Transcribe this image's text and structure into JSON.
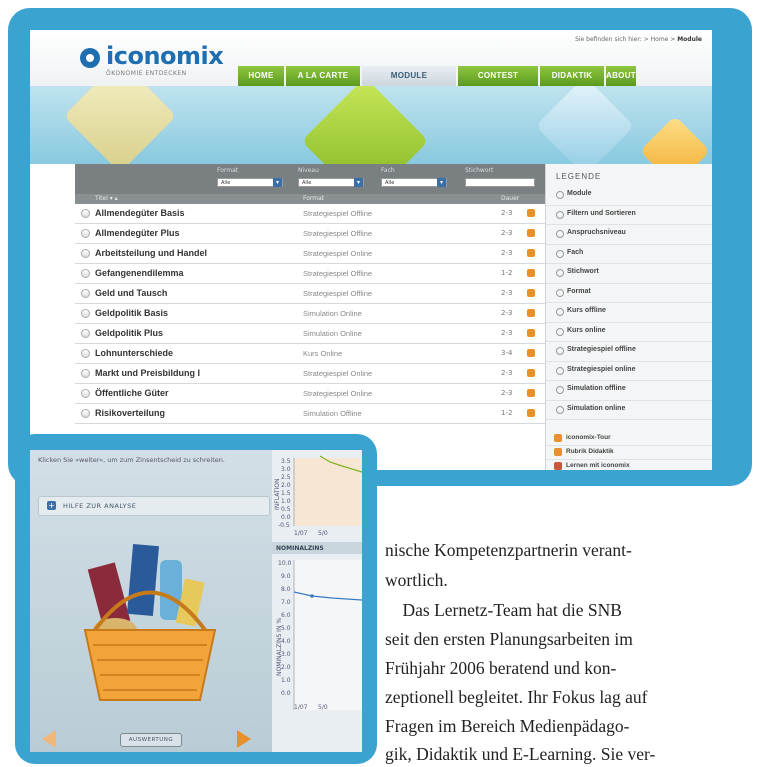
{
  "header": {
    "logo_text": "iconomix",
    "logo_sub": "ÖKONOMIE ENTDECKEN",
    "breadcrumb_prefix": "Sie befinden sich hier: > Home > ",
    "breadcrumb_current": "Module"
  },
  "nav": [
    {
      "label": "HOME"
    },
    {
      "label": "A LA CARTE"
    },
    {
      "label": "MODULE"
    },
    {
      "label": "CONTEST"
    },
    {
      "label": "DIDAKTIK"
    },
    {
      "label": "ABOUT"
    }
  ],
  "filters": {
    "format_label": "Format",
    "niveau_label": "Niveau",
    "fach_label": "Fach",
    "stichwort_label": "Stichwort",
    "format_value": "Alle",
    "niveau_value": "Alle",
    "fach_value": "Alle"
  },
  "table": {
    "col_title": "Titel ▾ ▴",
    "col_format": "Format",
    "col_dauer": "Dauer",
    "rows": [
      {
        "name": "Allmendegüter Basis",
        "format": "Strategiespiel Offline",
        "duration": "2-3"
      },
      {
        "name": "Allmendegüter Plus",
        "format": "Strategiespiel Offline",
        "duration": "2-3"
      },
      {
        "name": "Arbeitsteilung und Handel",
        "format": "Strategiespiel Online",
        "duration": "2-3"
      },
      {
        "name": "Gefangenendilemma",
        "format": "Strategiespiel Offline",
        "duration": "1-2"
      },
      {
        "name": "Geld und Tausch",
        "format": "Strategiespiel Offline",
        "duration": "2-3"
      },
      {
        "name": "Geldpolitik Basis",
        "format": "Simulation Online",
        "duration": "2-3"
      },
      {
        "name": "Geldpolitik Plus",
        "format": "Simulation Online",
        "duration": "2-3"
      },
      {
        "name": "Lohnunterschiede",
        "format": "Kurs Online",
        "duration": "3-4"
      },
      {
        "name": "Markt und Preisbildung I",
        "format": "Strategiespiel Online",
        "duration": "2-3"
      },
      {
        "name": "Öffentliche Güter",
        "format": "Strategiespiel Online",
        "duration": "2-3"
      },
      {
        "name": "Risikoverteilung",
        "format": "Simulation Offline",
        "duration": "1-2"
      }
    ]
  },
  "legend": {
    "title": "LEGENDE",
    "items": [
      {
        "label": "Module"
      },
      {
        "label": "Filtern und Sortieren"
      },
      {
        "label": "Anspruchsniveau"
      },
      {
        "label": "Fach"
      },
      {
        "label": "Stichwort"
      },
      {
        "label": "Format"
      },
      {
        "label": "Kurs offline"
      },
      {
        "label": "Kurs online"
      },
      {
        "label": "Strategiespiel offline"
      },
      {
        "label": "Strategiespiel online"
      },
      {
        "label": "Simulation offline"
      },
      {
        "label": "Simulation online"
      }
    ],
    "links": [
      {
        "label": "iconomix-Tour"
      },
      {
        "label": "Rubrik Didaktik"
      },
      {
        "label": "Lernen mit iconomix"
      }
    ]
  },
  "simulation": {
    "instruction": "Klicken Sie »weiter«, um zum Zinsentscheid zu schreiten.",
    "help_label": "HILFE ZUR ANALYSE",
    "eval_label": "AUSWERTUNG",
    "chart1_label": "INFLATION",
    "chart2_title": "NOMINALZINS",
    "chart2_axis": "NOMINALZINS IN %",
    "chart1_ticks": [
      "3.5",
      "3.0",
      "2.5",
      "2.0",
      "1.5",
      "1.0",
      "0.5",
      "0.0",
      "-0.5"
    ],
    "chart2_ticks": [
      "10.0",
      "9.0",
      "8.0",
      "7.0",
      "6.0",
      "5.0",
      "4.0",
      "3.0",
      "2.0",
      "1.0",
      "0.0"
    ],
    "x_tick_1": "1/07",
    "x_tick_2": "5/0"
  },
  "body_text": {
    "l1": "nische Kompetenzpartnerin verant-",
    "l2": "wortlich.",
    "l3": "    Das Lernetz-Team hat die SNB",
    "l4": "seit den ersten Planungsarbeiten im",
    "l5": "Frühjahr 2006 beratend und kon-",
    "l6": "zeptionell begleitet. Ihr Fokus lag auf",
    "l7": "Fragen im Bereich Medienpädago-",
    "l8": "gik, Didaktik und E-Learning. Sie ver-"
  }
}
